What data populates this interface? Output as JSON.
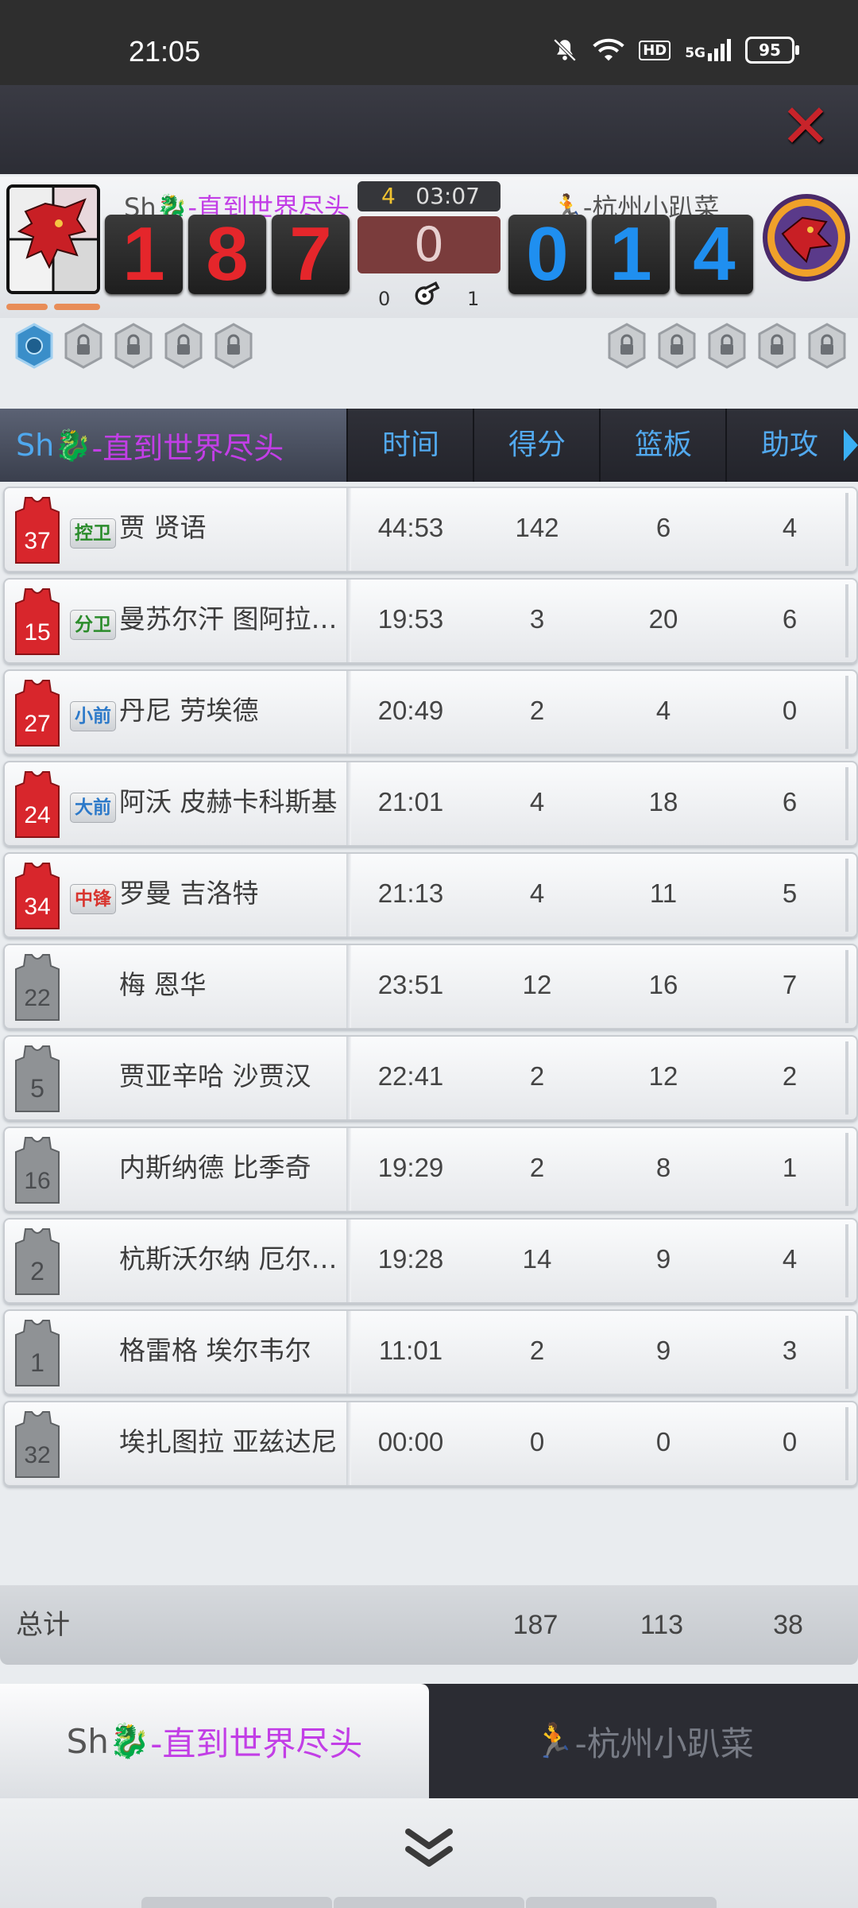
{
  "status_bar": {
    "time": "21:05",
    "hd": "HD",
    "network": "5G",
    "battery": "95"
  },
  "home_team": {
    "name_prefix": "Sh",
    "name_suffix": "-直到世界尽头",
    "score_digits": [
      "1",
      "8",
      "7"
    ],
    "name_color": "#c23ee6"
  },
  "away_team": {
    "name": "-杭州小趴菜",
    "score_digits": [
      "0",
      "1",
      "4"
    ]
  },
  "game": {
    "quarter": "4",
    "clock": "03:07",
    "possession_score": "0",
    "left_count": "0",
    "right_count": "1"
  },
  "table": {
    "team_label_prefix": "Sh",
    "team_label_suffix": "-直到世界尽头",
    "columns": [
      "时间",
      "得分",
      "篮板",
      "助攻"
    ],
    "rows": [
      {
        "number": "37",
        "position": "控卫",
        "pos_class": "pg",
        "name": "贾 贤语",
        "time": "44:53",
        "points": "142",
        "rebounds": "6",
        "assists": "4",
        "starter": true
      },
      {
        "number": "15",
        "position": "分卫",
        "pos_class": "pg",
        "name": "曼苏尔汗 图阿拉…",
        "time": "19:53",
        "points": "3",
        "rebounds": "20",
        "assists": "6",
        "starter": true
      },
      {
        "number": "27",
        "position": "小前",
        "pos_class": "pb",
        "name": "丹尼 劳埃德",
        "time": "20:49",
        "points": "2",
        "rebounds": "4",
        "assists": "0",
        "starter": true
      },
      {
        "number": "24",
        "position": "大前",
        "pos_class": "pb",
        "name": "阿沃 皮赫卡科斯基",
        "time": "21:01",
        "points": "4",
        "rebounds": "18",
        "assists": "6",
        "starter": true
      },
      {
        "number": "34",
        "position": "中锋",
        "pos_class": "pr",
        "name": "罗曼 吉洛特",
        "time": "21:13",
        "points": "4",
        "rebounds": "11",
        "assists": "5",
        "starter": true
      },
      {
        "number": "22",
        "position": "",
        "pos_class": "",
        "name": "梅 恩华",
        "time": "23:51",
        "points": "12",
        "rebounds": "16",
        "assists": "7",
        "starter": false
      },
      {
        "number": "5",
        "position": "",
        "pos_class": "",
        "name": "贾亚辛哈 沙贾汉",
        "time": "22:41",
        "points": "2",
        "rebounds": "12",
        "assists": "2",
        "starter": false
      },
      {
        "number": "16",
        "position": "",
        "pos_class": "",
        "name": "内斯纳德 比季奇",
        "time": "19:29",
        "points": "2",
        "rebounds": "8",
        "assists": "1",
        "starter": false
      },
      {
        "number": "2",
        "position": "",
        "pos_class": "",
        "name": "杭斯沃尔纳 厄尔…",
        "time": "19:28",
        "points": "14",
        "rebounds": "9",
        "assists": "4",
        "starter": false
      },
      {
        "number": "1",
        "position": "",
        "pos_class": "",
        "name": "格雷格 埃尔韦尔",
        "time": "11:01",
        "points": "2",
        "rebounds": "9",
        "assists": "3",
        "starter": false
      },
      {
        "number": "32",
        "position": "",
        "pos_class": "",
        "name": "埃扎图拉 亚兹达尼",
        "time": "00:00",
        "points": "0",
        "rebounds": "0",
        "assists": "0",
        "starter": false
      }
    ]
  },
  "totals": {
    "label": "总计",
    "points": "187",
    "rebounds": "113",
    "assists": "38"
  },
  "tabs": {
    "home_prefix": "Sh",
    "home_suffix": "-直到世界尽头",
    "away": "-杭州小趴菜"
  },
  "colors": {
    "starter_jersey": "#d8262c",
    "bench_jersey": "#8f9295",
    "home_score": "#e5262b",
    "away_score": "#1f8ff0"
  }
}
